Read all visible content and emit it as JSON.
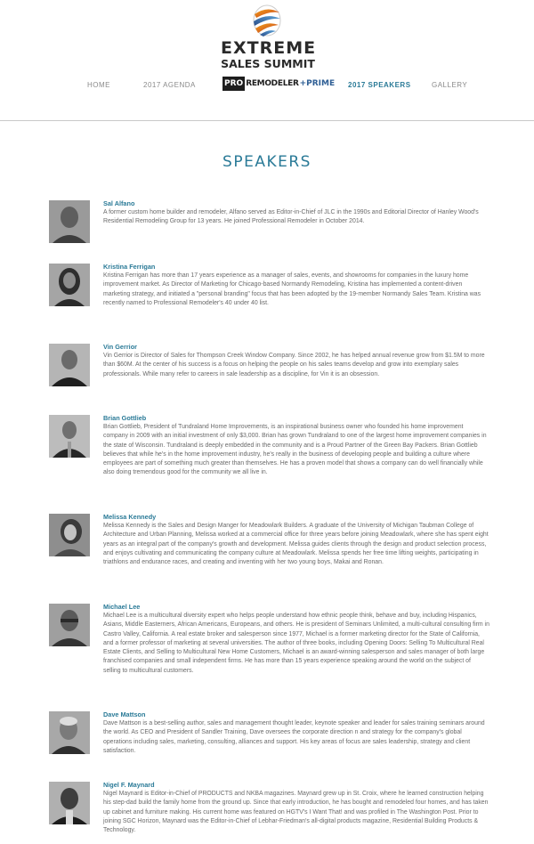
{
  "logo": {
    "line1": "EXTREME",
    "line2": "SALES SUMMIT",
    "pro": "PRO",
    "remodeler": "REMODELER",
    "prime": "+PRIME"
  },
  "nav": {
    "items": [
      {
        "label": "HOME"
      },
      {
        "label": "2017 AGENDA"
      },
      {
        "label": "2017 SPEAKERS"
      },
      {
        "label": "GALLERY"
      }
    ]
  },
  "colors": {
    "accent": "#2a7a97",
    "text": "#6a6a6a"
  },
  "page": {
    "title": "SPEAKERS"
  },
  "speakers": [
    {
      "name": "Sal Alfano",
      "bio": "A former custom home builder and remodeler, Alfano served as Editor-in-Chief of JLC in the 1990s and Editorial Director of Hanley Wood's Residential Remodeling Group for 13 years. He joined Professional Remodeler in October 2014."
    },
    {
      "name": "Kristina Ferrigan",
      "bio": "Kristina Ferrigan has more than 17 years experience as a manager of sales, events, and showrooms for companies in the luxury home improvement market. As Director of Marketing for Chicago-based Normandy Remodeling, Kristina has implemented a content-driven marketing strategy, and initiated a \"personal branding\" focus that has been adopted by the 19-member Normandy Sales Team. Kristina was recently named to Professional Remodeler's 40 under 40 list."
    },
    {
      "name": "Vin Gerrior",
      "bio": "Vin Gerrior is Director of Sales for Thompson Creek Window Company. Since 2002, he has helped annual revenue grow from $1.5M to more than $60M. At the center of his success is a focus on helping the people on his sales teams develop and grow into exemplary sales professionals. While many refer to careers in sale leadership as a discipline, for Vin it is an obsession."
    },
    {
      "name": "Brian Gottlieb",
      "bio": "Brian Gottlieb, President of Tundraland Home Improvements, is an inspirational business owner who founded his home improvement company in 2009 with an initial investment of only $3,000. Brian has grown Tundraland to one of the largest home improvement companies in the state of Wisconsin. Tundraland is deeply embedded in the community and is a Proud Partner of the Green Bay Packers. Brian Gottlieb believes that while he's in the home improvement industry, he's really in the business of developing people and building a culture where employees are part of something much greater than themselves. He has a proven model that shows a company can do well financially while also doing tremendous good for the community we all live in."
    },
    {
      "name": "Melissa Kennedy",
      "bio": "Melissa Kennedy is the Sales and Design Manger for Meadowlark Builders. A graduate of the University of Michigan Taubman College of Architecture and Urban Planning, Melissa worked at a commercial office for three years before joining Meadowlark, where she has spent eight years as an integral part of the company's growth and development. Melissa guides clients through the design and product selection process, and enjoys cultivating and communicating the company culture at Meadowlark. Melissa spends her free time lifting weights, participating in triathlons and endurance races, and creating and inventing with her two young boys, Makai and Ronan."
    },
    {
      "name": "Michael Lee",
      "bio": "Michael Lee is a multicultural diversity expert who helps people understand how ethnic people think, behave and buy, including Hispanics, Asians, Middle Easterners, African Americans, Europeans, and others. He is president of Seminars Unlimited, a multi-cultural consulting firm in Castro Valley, California. A real estate broker and salesperson since 1977, Michael is a former marketing director for the State of California, and a former professor of marketing at several universities. The author of three books, including Opening Doors: Selling To Multicultural Real Estate Clients, and Selling to Multicultural New Home Customers, Michael is an award-winning salesperson and sales manager of both large franchised companies and small independent firms. He has more than 15 years experience speaking around the world on the subject of selling to multicultural customers."
    },
    {
      "name": "Dave Mattson",
      "bio": "Dave Mattson is a best-selling author, sales and management thought leader, keynote speaker and leader for sales training seminars around the world. As CEO and President of Sandler Training, Dave oversees the corporate direction n and strategy for the company's global operations including sales, marketing, consulting, alliances and support. His key areas of focus are sales leadership, strategy and client satisfaction."
    },
    {
      "name": "Nigel F. Maynard",
      "bio": "Nigel Maynard is Editor-in-Chief of PRODUCTS and NKBA magazines. Maynard grew up in St. Croix, where he learned construction helping his step-dad build the family home from the ground up. Since that early introduction, he has bought and remodeled four homes, and has taken up cabinet and furniture making. His current home was featured on HGTV's I Want That! and was profiled in The Washington Post. Prior to joining SGC Horizon, Maynard was the Editor-in-Chief of Lebhar-Friedman's all-digital products magazine, Residential Building Products & Technology."
    }
  ]
}
